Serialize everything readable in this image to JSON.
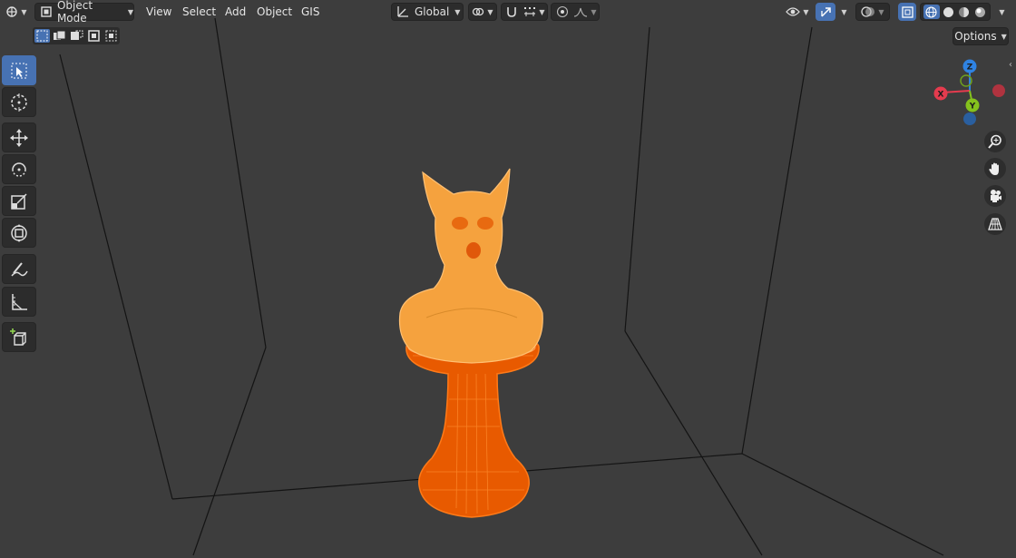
{
  "header": {
    "mode_label": "Object Mode",
    "menus": [
      "View",
      "Select",
      "Add",
      "Object",
      "GIS"
    ],
    "transform_orientation": "Global",
    "options_label": "Options"
  },
  "icons": {
    "editor_type": "editor-type-icon",
    "object_mode": "object-mode-icon",
    "orientation": "transform-orientation-icon",
    "pivot": "pivot-point-icon",
    "snap": "snap-magnet-icon",
    "snap_target": "snap-increment-icon",
    "proportional": "proportional-edit-icon",
    "falloff": "falloff-curve-icon",
    "visibility": "visibility-eye-icon",
    "gizmos": "gizmo-toggle-icon",
    "overlays": "overlay-icon",
    "xray": "xray-toggle-icon",
    "shading": [
      "wireframe-shading-icon",
      "solid-shading-icon",
      "material-shading-icon",
      "rendered-shading-icon"
    ]
  },
  "toolbar": {
    "tools": [
      "select-box",
      "cursor",
      "move",
      "rotate",
      "scale",
      "transform",
      "annotate",
      "measure",
      "add-cube"
    ],
    "active": "select-box"
  },
  "gizmo": {
    "x_label": "X",
    "y_label": "Y",
    "z_label": "Z"
  },
  "colors": {
    "viewport_bg": "#3d3d3d",
    "accent_active": "#4772b3",
    "selected_object": "#f6a13a",
    "active_object": "#ff6a00",
    "axis_x": "#e53b4e",
    "axis_y": "#85c21d",
    "axis_z": "#2f83e3"
  }
}
